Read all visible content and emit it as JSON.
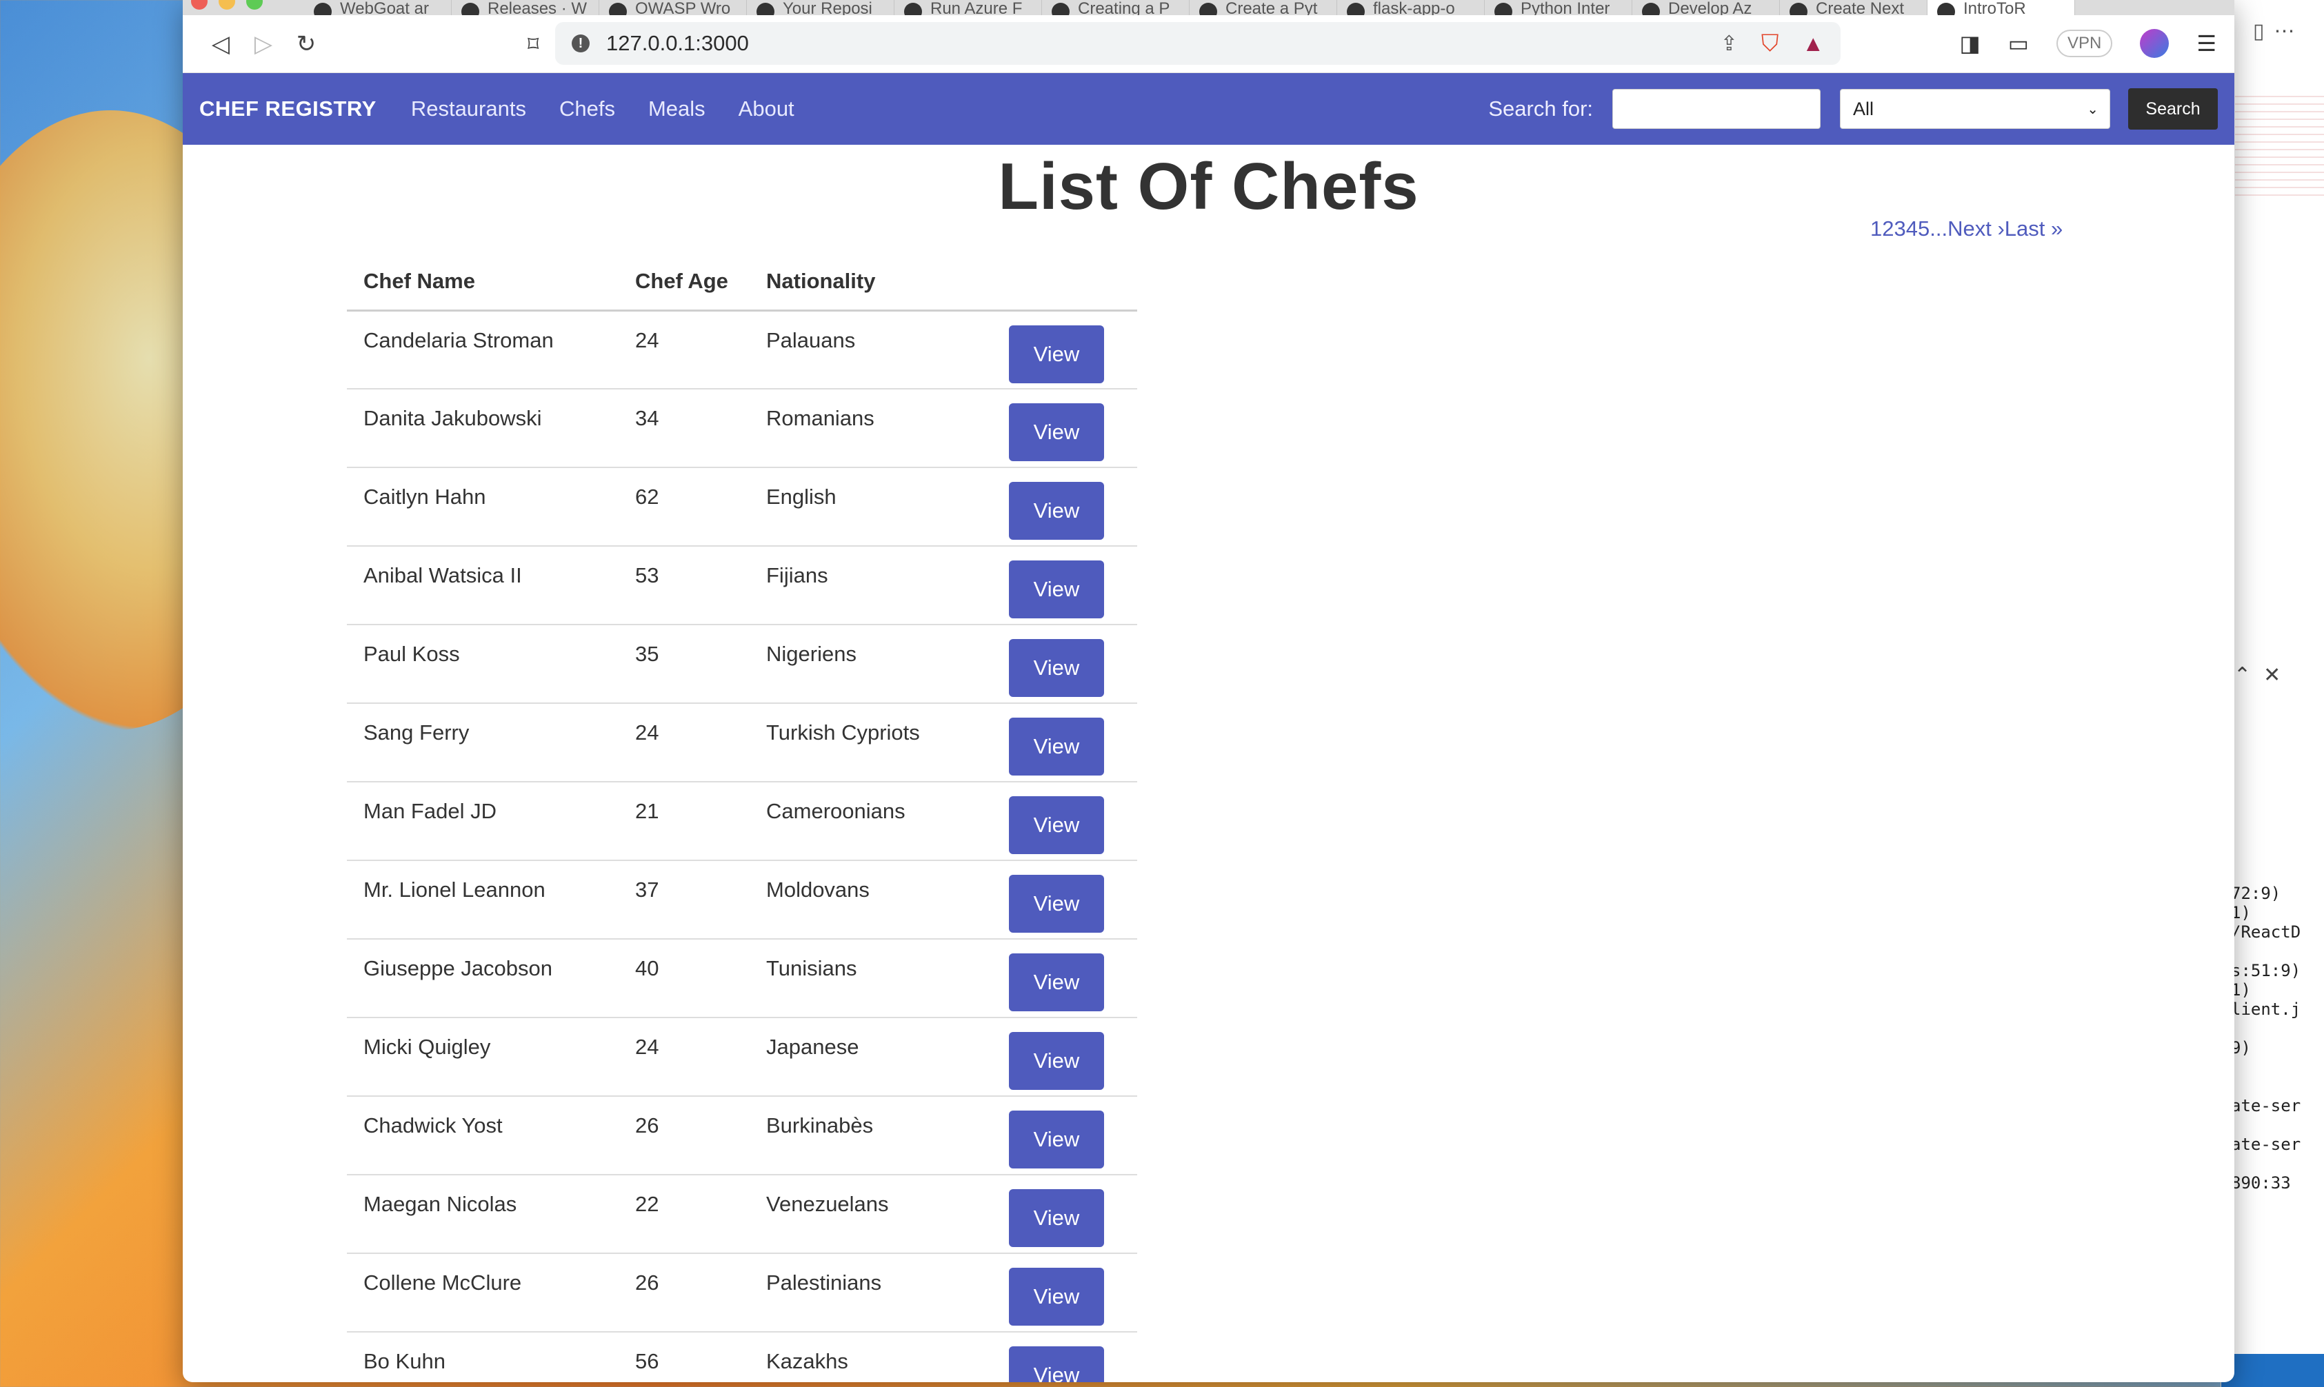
{
  "browser": {
    "tabs": [
      {
        "label": "WebGoat ar"
      },
      {
        "label": "Releases · W"
      },
      {
        "label": "OWASP Wro"
      },
      {
        "label": "Your Reposi"
      },
      {
        "label": "Run Azure F"
      },
      {
        "label": "Creating a P"
      },
      {
        "label": "Create a Pyt"
      },
      {
        "label": "flask-app-o"
      },
      {
        "label": "Python Inter"
      },
      {
        "label": "Develop Az"
      },
      {
        "label": "Create Next"
      },
      {
        "label": "IntroToR"
      }
    ],
    "address": "127.0.0.1:3000",
    "vpn_label": "VPN"
  },
  "navbar": {
    "brand": "CHEF REGISTRY",
    "links": [
      "Restaurants",
      "Chefs",
      "Meals",
      "About"
    ],
    "search_label": "Search for:",
    "search_value": "",
    "select_value": "All",
    "search_button": "Search"
  },
  "page": {
    "title": "List Of Chefs",
    "pagination": {
      "pages": [
        "1",
        "2",
        "3",
        "4",
        "5"
      ],
      "ellipsis": "...",
      "next": "Next ›",
      "last": "Last »"
    }
  },
  "table": {
    "headers": [
      "Chef Name",
      "Chef Age",
      "Nationality"
    ],
    "rows": [
      {
        "name": "Candelaria Stroman",
        "age": "24",
        "nationality": "Palauans",
        "action": "View"
      },
      {
        "name": "Danita Jakubowski",
        "age": "34",
        "nationality": "Romanians",
        "action": "View"
      },
      {
        "name": "Caitlyn Hahn",
        "age": "62",
        "nationality": "English",
        "action": "View"
      },
      {
        "name": "Anibal Watsica II",
        "age": "53",
        "nationality": "Fijians",
        "action": "View"
      },
      {
        "name": "Paul Koss",
        "age": "35",
        "nationality": "Nigeriens",
        "action": "View"
      },
      {
        "name": "Sang Ferry",
        "age": "24",
        "nationality": "Turkish Cypriots",
        "action": "View"
      },
      {
        "name": "Man Fadel JD",
        "age": "21",
        "nationality": "Cameroonians",
        "action": "View"
      },
      {
        "name": "Mr. Lionel Leannon",
        "age": "37",
        "nationality": "Moldovans",
        "action": "View"
      },
      {
        "name": "Giuseppe Jacobson",
        "age": "40",
        "nationality": "Tunisians",
        "action": "View"
      },
      {
        "name": "Micki Quigley",
        "age": "24",
        "nationality": "Japanese",
        "action": "View"
      },
      {
        "name": "Chadwick Yost",
        "age": "26",
        "nationality": "Burkinabès",
        "action": "View"
      },
      {
        "name": "Maegan Nicolas",
        "age": "22",
        "nationality": "Venezuelans",
        "action": "View"
      },
      {
        "name": "Collene McClure",
        "age": "26",
        "nationality": "Palestinians",
        "action": "View"
      },
      {
        "name": "Bo Kuhn",
        "age": "56",
        "nationality": "Kazakhs",
        "action": "View"
      }
    ]
  },
  "background_window": {
    "code_lines": [
      "72:9)",
      "1)",
      "/ReactD",
      "",
      "s:51:9)",
      "1)",
      "lient.j",
      "",
      "9)",
      "",
      "",
      "ate-ser",
      "",
      "ate-ser",
      "",
      "890:33"
    ]
  },
  "colors": {
    "navbar": "#4f5bbd",
    "button": "#4f5bbd",
    "search_button": "#2e2e2e"
  }
}
